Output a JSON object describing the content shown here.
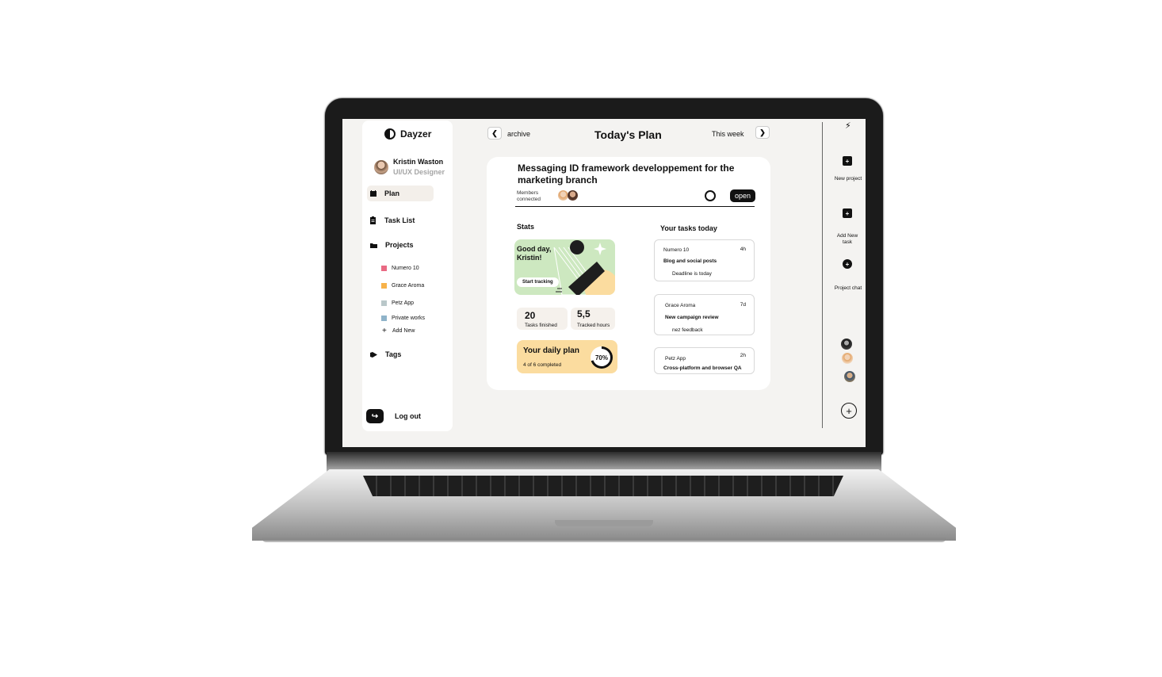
{
  "app": {
    "name": "Dayzer"
  },
  "user": {
    "name": "Kristin Waston",
    "role": "UI/UX Designer"
  },
  "nav": [
    {
      "label": "Plan",
      "icon": "calendar-icon"
    },
    {
      "label": "Task List",
      "icon": "clipboard-icon"
    },
    {
      "label": "Projects",
      "icon": "folder-icon"
    },
    {
      "label": "Tags",
      "icon": "tag-icon"
    }
  ],
  "projects": [
    {
      "label": "Numero 10",
      "color": "#e96a83"
    },
    {
      "label": "Grace Aroma",
      "color": "#f7b24a"
    },
    {
      "label": "Petz App",
      "color": "#b9c7c9"
    },
    {
      "label": "Private works",
      "color": "#8fb3c9"
    }
  ],
  "add_new": "Add New",
  "logout": "Log out",
  "header": {
    "archive": "archive",
    "title": "Today's  Plan",
    "week": "This week"
  },
  "card": {
    "title": "Messaging ID framework developpement for the marketing branch",
    "members_label": "Members connected",
    "open_label": "open",
    "stats_label": "Stats",
    "tasks_label": "Your tasks today",
    "greeting": "Good day, Kristin!",
    "start_tracking": "Start tracking",
    "tasks_finished": {
      "value": "20",
      "label": "Tasks finished"
    },
    "tracked_hours": {
      "value": "5,5",
      "label": "Tracked hours"
    },
    "daily_plan": {
      "title": "Your daily plan",
      "sub": "4 of 6 completed",
      "percent_label": "70%",
      "percent": 70
    }
  },
  "tasks": [
    {
      "project": "Numero 10",
      "time": "4h",
      "name": "Blog and social posts",
      "note": "Deadline  is  today"
    },
    {
      "project": "Grace Aroma",
      "time": "7d",
      "name": "New campaign review",
      "note": "nez feedback"
    },
    {
      "project": "Petz App",
      "time": "2h",
      "name": "Cross-platform and browser QA",
      "note": ""
    }
  ],
  "rail": {
    "new_project": "New project",
    "add_new_task": "Add New task",
    "project_chat": "Project chat"
  },
  "colors": {
    "greeting_bg": "#cde8c0",
    "plan_bg": "#fbdc9f",
    "screen_bg": "#f4f3f1"
  }
}
